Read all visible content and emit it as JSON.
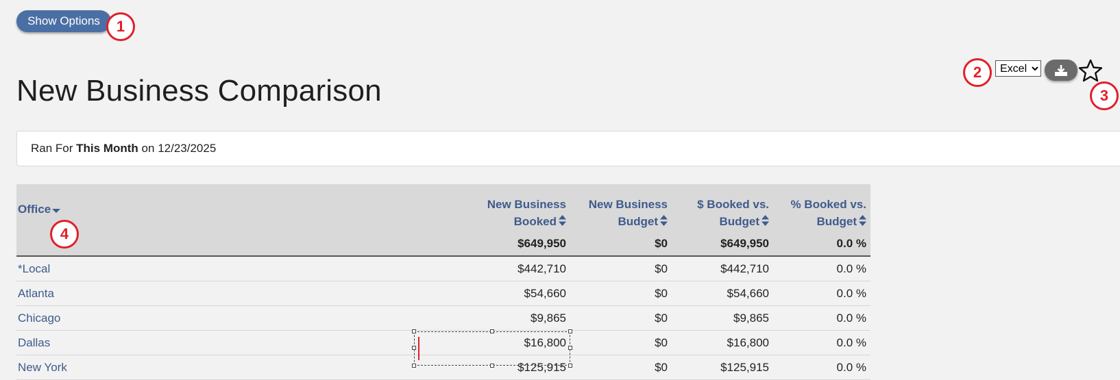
{
  "toolbar": {
    "show_options_label": "Show Options",
    "export_format": {
      "selected": "Excel",
      "options": [
        "Excel"
      ]
    },
    "download_icon": "download-icon",
    "favorite_icon": "star-outline-icon"
  },
  "annotations": [
    "1",
    "2",
    "3",
    "4"
  ],
  "page": {
    "title": "New Business Comparison"
  },
  "run_info": {
    "prefix": "Ran For",
    "period": "This Month",
    "on_label": "on",
    "date": "12/23/2025"
  },
  "table": {
    "columns": {
      "office": "Office",
      "booked_line1": "New Business",
      "booked_line2": "Booked",
      "budget_line1": "New Business",
      "budget_line2": "Budget",
      "booked_vs_line1": "$ Booked vs.",
      "booked_vs_line2": "Budget",
      "pct_vs_line1": "% Booked vs.",
      "pct_vs_line2": "Budget"
    },
    "totals": {
      "booked": "$649,950",
      "budget": "$0",
      "booked_vs_budget": "$649,950",
      "pct_vs_budget": "0.0 %"
    },
    "rows": [
      {
        "office": "*Local",
        "booked": "$442,710",
        "budget": "$0",
        "booked_vs_budget": "$442,710",
        "pct_vs_budget": "0.0 %"
      },
      {
        "office": "Atlanta",
        "booked": "$54,660",
        "budget": "$0",
        "booked_vs_budget": "$54,660",
        "pct_vs_budget": "0.0 %"
      },
      {
        "office": "Chicago",
        "booked": "$9,865",
        "budget": "$0",
        "booked_vs_budget": "$9,865",
        "pct_vs_budget": "0.0 %"
      },
      {
        "office": "Dallas",
        "booked": "$16,800",
        "budget": "$0",
        "booked_vs_budget": "$16,800",
        "pct_vs_budget": "0.0 %"
      },
      {
        "office": "New York",
        "booked": "$125,915",
        "budget": "$0",
        "booked_vs_budget": "$125,915",
        "pct_vs_budget": "0.0 %"
      }
    ]
  },
  "colors": {
    "accent_button": "#4a6fa5",
    "link_text": "#3e5b8c",
    "annotation_red": "#e0202a",
    "header_bg": "#d9d9d9",
    "page_bg": "#f2f2f2"
  }
}
